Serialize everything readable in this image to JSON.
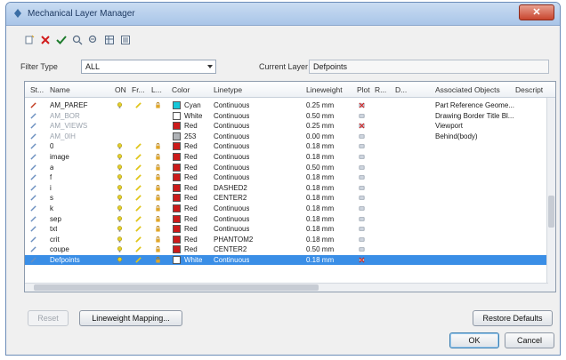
{
  "window": {
    "title": "Mechanical Layer Manager"
  },
  "filter": {
    "label": "Filter Type",
    "value": "ALL"
  },
  "current_layer": {
    "label": "Current Layer",
    "value": "Defpoints"
  },
  "columns": [
    "St...",
    "Name",
    "ON",
    "Fr...",
    "L...",
    "Color",
    "Linetype",
    "Lineweight",
    "Plot",
    "R...",
    "D...",
    "Associated Objects",
    "Descript"
  ],
  "rows": [
    {
      "name": "AM_PAREF",
      "state": "normal",
      "color_name": "Cyan",
      "color": "#16c7d9",
      "linetype": "Continuous",
      "lineweight": "0.25 mm",
      "plot": "no",
      "assoc": "Part Reference Geome...",
      "on": true
    },
    {
      "name": "AM_BOR",
      "state": "dim",
      "color_name": "White",
      "color": "#ffffff",
      "linetype": "Continuous",
      "lineweight": "0.50 mm",
      "plot": "yes",
      "assoc": "Drawing Border Title Bl...",
      "on": false
    },
    {
      "name": "AM_VIEWS",
      "state": "dim",
      "color_name": "Red",
      "color": "#cc1b1b",
      "linetype": "Continuous",
      "lineweight": "0.25 mm",
      "plot": "no",
      "assoc": "Viewport",
      "on": false
    },
    {
      "name": "AM_0IH",
      "state": "dim",
      "color_name": "253",
      "color": "#b0b3b7",
      "linetype": "Continuous",
      "lineweight": "0.00 mm",
      "plot": "yes",
      "assoc": "Behind(body)",
      "on": false
    },
    {
      "name": "0",
      "state": "normal",
      "color_name": "Red",
      "color": "#cc1b1b",
      "linetype": "Continuous",
      "lineweight": "0.18 mm",
      "plot": "yes",
      "assoc": "",
      "on": true
    },
    {
      "name": "image",
      "state": "normal",
      "color_name": "Red",
      "color": "#cc1b1b",
      "linetype": "Continuous",
      "lineweight": "0.18 mm",
      "plot": "yes",
      "assoc": "",
      "on": true
    },
    {
      "name": "a",
      "state": "normal",
      "color_name": "Red",
      "color": "#cc1b1b",
      "linetype": "Continuous",
      "lineweight": "0.50 mm",
      "plot": "yes",
      "assoc": "",
      "on": true
    },
    {
      "name": "f",
      "state": "normal",
      "color_name": "Red",
      "color": "#cc1b1b",
      "linetype": "Continuous",
      "lineweight": "0.18 mm",
      "plot": "yes",
      "assoc": "",
      "on": true
    },
    {
      "name": "i",
      "state": "normal",
      "color_name": "Red",
      "color": "#cc1b1b",
      "linetype": "DASHED2",
      "lineweight": "0.18 mm",
      "plot": "yes",
      "assoc": "",
      "on": true
    },
    {
      "name": "s",
      "state": "normal",
      "color_name": "Red",
      "color": "#cc1b1b",
      "linetype": "CENTER2",
      "lineweight": "0.18 mm",
      "plot": "yes",
      "assoc": "",
      "on": true
    },
    {
      "name": "k",
      "state": "normal",
      "color_name": "Red",
      "color": "#cc1b1b",
      "linetype": "Continuous",
      "lineweight": "0.18 mm",
      "plot": "yes",
      "assoc": "",
      "on": true
    },
    {
      "name": "sep",
      "state": "normal",
      "color_name": "Red",
      "color": "#cc1b1b",
      "linetype": "Continuous",
      "lineweight": "0.18 mm",
      "plot": "yes",
      "assoc": "",
      "on": true
    },
    {
      "name": "txt",
      "state": "normal",
      "color_name": "Red",
      "color": "#cc1b1b",
      "linetype": "Continuous",
      "lineweight": "0.18 mm",
      "plot": "yes",
      "assoc": "",
      "on": true
    },
    {
      "name": "crit",
      "state": "normal",
      "color_name": "Red",
      "color": "#cc1b1b",
      "linetype": "PHANTOM2",
      "lineweight": "0.18 mm",
      "plot": "yes",
      "assoc": "",
      "on": true
    },
    {
      "name": "coupe",
      "state": "normal",
      "color_name": "Red",
      "color": "#cc1b1b",
      "linetype": "CENTER2",
      "lineweight": "0.50 mm",
      "plot": "yes",
      "assoc": "",
      "on": true
    },
    {
      "name": "Defpoints",
      "state": "selected",
      "color_name": "White",
      "color": "#ffffff",
      "linetype": "Continuous",
      "lineweight": "0.18 mm",
      "plot": "no",
      "assoc": "",
      "on": true
    }
  ],
  "buttons": {
    "reset": "Reset",
    "lineweight_mapping": "Lineweight Mapping...",
    "restore_defaults": "Restore Defaults",
    "ok": "OK",
    "cancel": "Cancel"
  },
  "colors": {
    "selection": "#3a8ee6",
    "accent": "#cc1b1b",
    "bulb": "#e6d02a"
  }
}
